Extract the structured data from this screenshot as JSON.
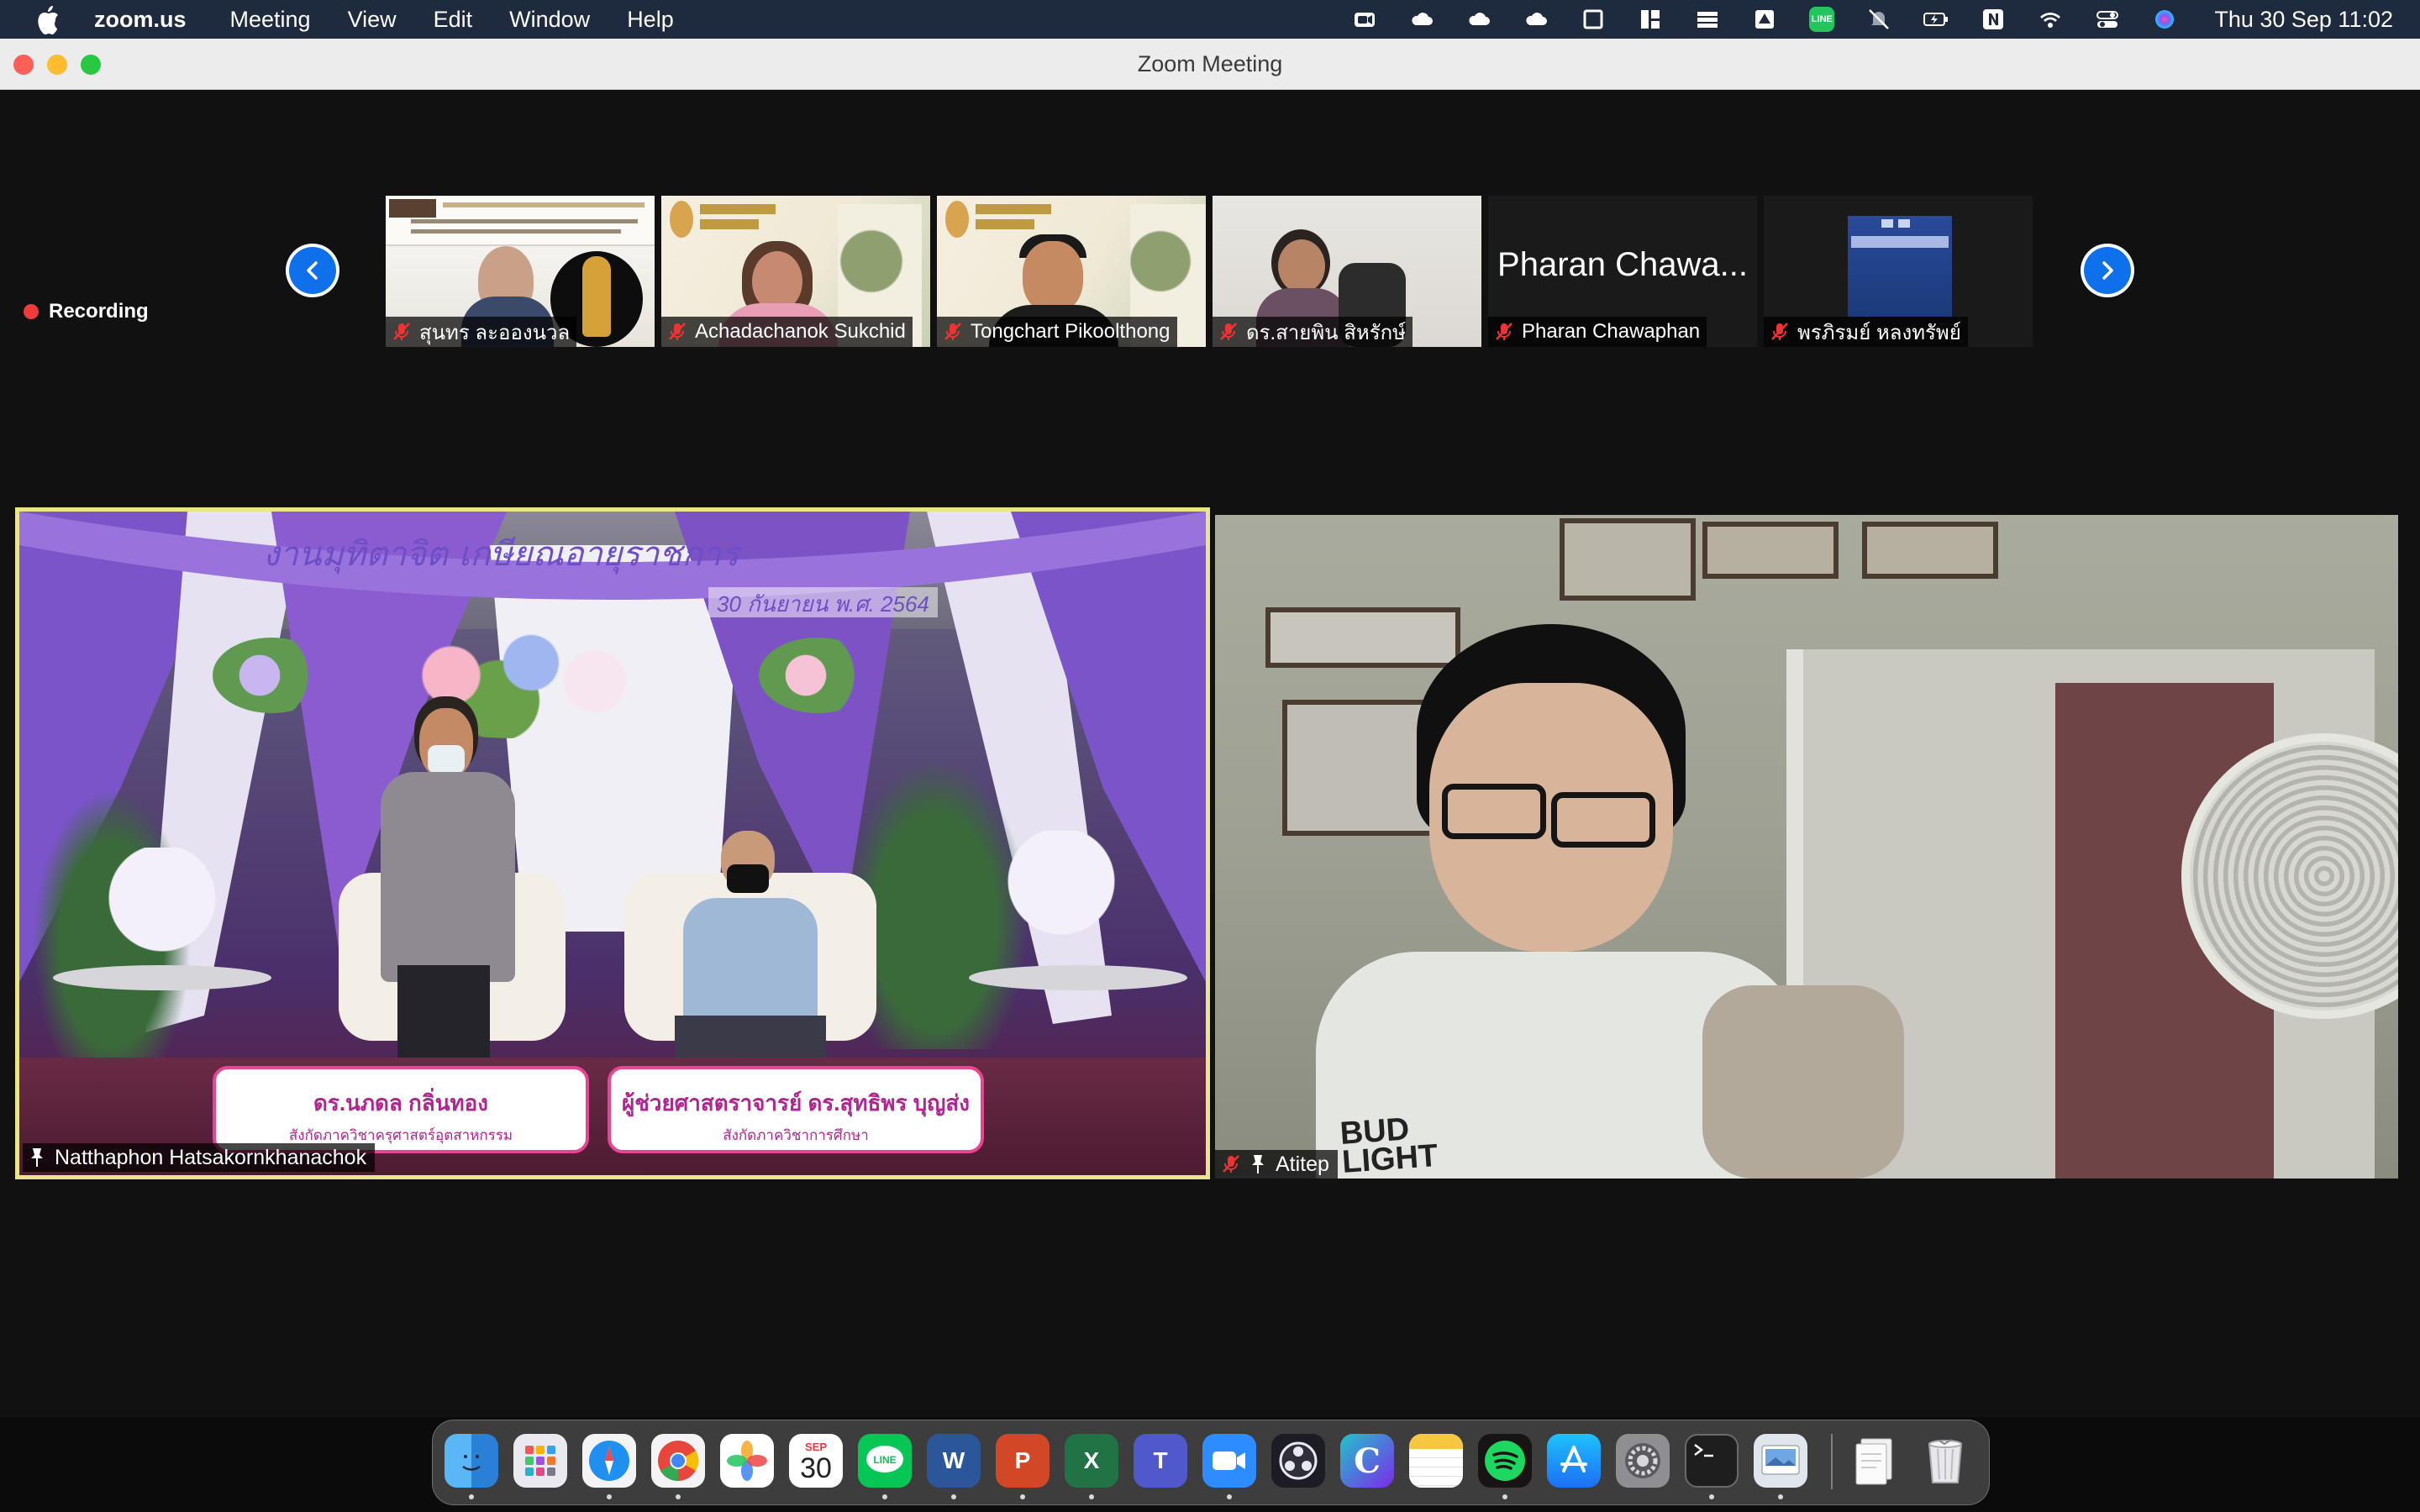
{
  "menubar": {
    "app_name": "zoom.us",
    "menus": [
      "Meeting",
      "View",
      "Edit",
      "Window",
      "Help"
    ],
    "status_icons": [
      "zoom-video-icon",
      "cloud-icon",
      "cloud-icon",
      "cloud-icon",
      "window-icon",
      "layout-icon",
      "stack-icon",
      "drive-icon",
      "line-app-icon",
      "mute-bell-icon",
      "battery-charging-icon",
      "notion-icon",
      "wifi-icon",
      "control-center-icon",
      "siri-icon"
    ],
    "line_badge": "LINE",
    "clock": "Thu 30 Sep  11:02"
  },
  "window": {
    "title": "Zoom Meeting"
  },
  "recording": {
    "label": "Recording"
  },
  "gallery": {
    "participants": [
      {
        "name": "สุนทร ละอองนวล",
        "muted": true
      },
      {
        "name": "Achadachanok Sukchid",
        "muted": true
      },
      {
        "name": "Tongchart Pikoolthong",
        "muted": true
      },
      {
        "name": "ดร.สายพิน  สิหรักษ์",
        "muted": true
      },
      {
        "name": "Pharan Chawaphan",
        "muted": true,
        "avatar_text": "Pharan Chawa..."
      },
      {
        "name": "พรภิรมย์ หลงทรัพย์",
        "muted": true
      }
    ]
  },
  "main_tiles": [
    {
      "name": "Natthaphon Hatsakornkhanachok",
      "active_speaker": true,
      "banner_text": "งานมุทิตาจิต เกษียณอายุราชการ",
      "banner_date": "30 กันยายน พ.ศ. 2564",
      "captions": [
        {
          "title": "ดร.นภดล กลิ่นทอง",
          "subtitle": "สังกัดภาควิชาครุศาสตร์อุตสาหกรรม"
        },
        {
          "title": "ผู้ช่วยศาสตราจารย์ ดร.สุทธิพร บุญส่ง",
          "subtitle": "สังกัดภาควิชาการศึกษา"
        }
      ]
    },
    {
      "name": "Atitep",
      "muted": true,
      "shirt_text": "BUD LIGHT"
    }
  ],
  "dock": {
    "calendar_month": "SEP",
    "calendar_day": "30",
    "apps": [
      "Finder",
      "Launchpad",
      "Safari",
      "Chrome",
      "Photos",
      "Calendar",
      "LINE",
      "Word",
      "PowerPoint",
      "Excel",
      "Teams",
      "Zoom",
      "OBS",
      "Canva",
      "Notes",
      "Spotify",
      "App Store",
      "System Preferences",
      "Terminal",
      "Preview",
      "Documents",
      "Trash"
    ]
  }
}
